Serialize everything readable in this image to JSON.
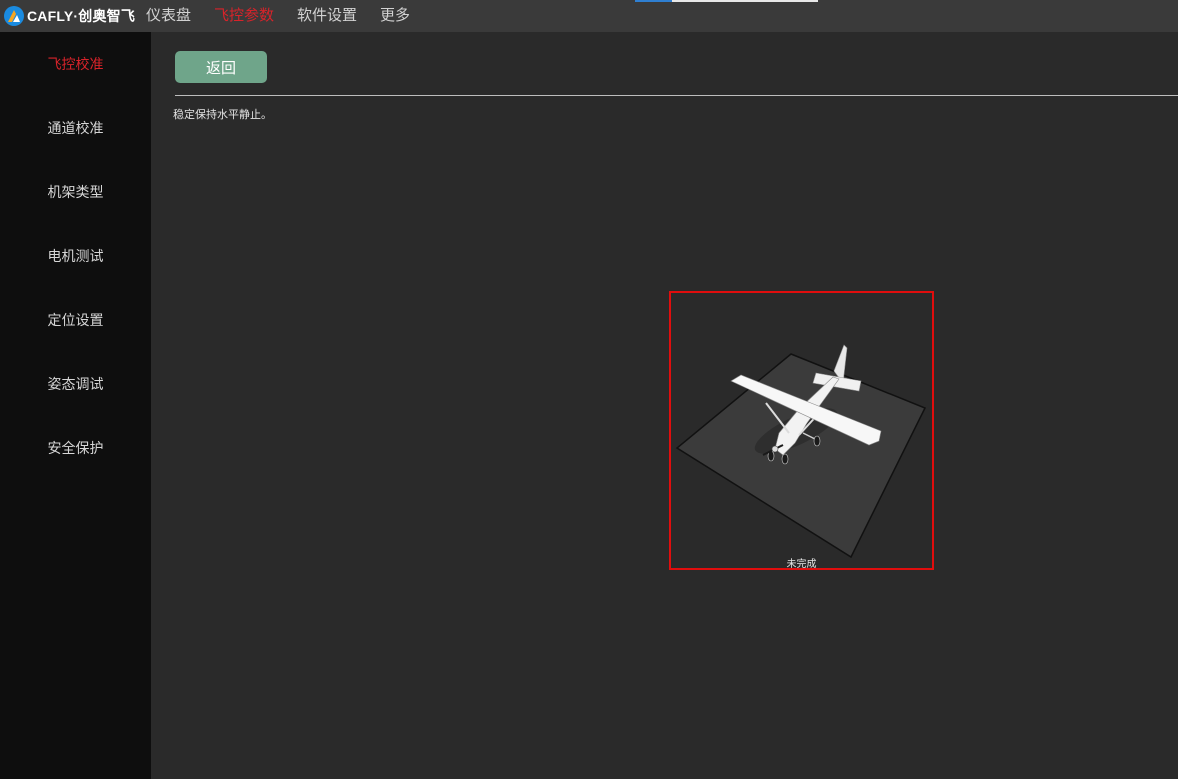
{
  "app": {
    "brand": "CAFLY·创奥智飞",
    "logo_icon": "cafly-logo-icon",
    "calibration_progress": 0.2
  },
  "menu": {
    "items": [
      {
        "label": "仪表盘",
        "active": false
      },
      {
        "label": "飞控参数",
        "active": true
      },
      {
        "label": "软件设置",
        "active": false
      },
      {
        "label": "更多",
        "active": false
      }
    ]
  },
  "sidebar": {
    "items": [
      {
        "label": "飞控校准",
        "active": true
      },
      {
        "label": "通道校准",
        "active": false
      },
      {
        "label": "机架类型",
        "active": false
      },
      {
        "label": "电机测试",
        "active": false
      },
      {
        "label": "定位设置",
        "active": false
      },
      {
        "label": "姿态调试",
        "active": false
      },
      {
        "label": "安全保护",
        "active": false
      }
    ]
  },
  "main": {
    "back_label": "返回",
    "instruction": "稳定保持水平静止。",
    "status": "未完成"
  },
  "colors": {
    "accent_active": "#d8232a",
    "button_bg": "#6fa58a",
    "viewer_border": "#e00d0d",
    "topbar_bg": "#3a3a3a",
    "sidebar_bg": "#0e0e0e",
    "main_bg": "#2a2a2a"
  }
}
